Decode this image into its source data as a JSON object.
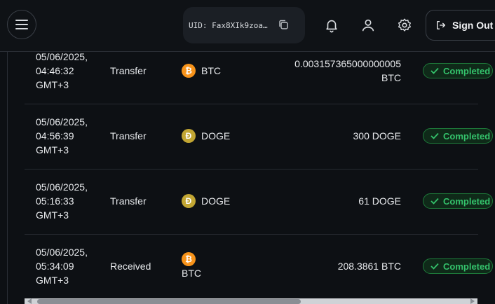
{
  "header": {
    "uid_text": "UID: Fax8XIk9zoa…",
    "signout_label": "Sign Out"
  },
  "transactions": [
    {
      "date_line1": "05/06/2025,",
      "date_line2": "04:46:32",
      "date_line3": "GMT+3",
      "type": "Transfer",
      "asset": "BTC",
      "amount_line1": "0.003157365000000005",
      "amount_line2": "BTC",
      "status": "Completed"
    },
    {
      "date_line1": "05/06/2025,",
      "date_line2": "04:56:39",
      "date_line3": "GMT+3",
      "type": "Transfer",
      "asset": "DOGE",
      "amount_line1": "300 DOGE",
      "status": "Completed"
    },
    {
      "date_line1": "05/06/2025,",
      "date_line2": "05:16:33",
      "date_line3": "GMT+3",
      "type": "Transfer",
      "asset": "DOGE",
      "amount_line1": "61 DOGE",
      "status": "Completed"
    },
    {
      "date_line1": "05/06/2025,",
      "date_line2": "05:34:09",
      "date_line3": "GMT+3",
      "type": "Received",
      "asset": "BTC",
      "amount_line1": "208.3861 BTC",
      "status": "Completed"
    }
  ],
  "colors": {
    "background": "#0d1014",
    "btc": "#f7931a",
    "doge": "#c2a633",
    "status_green": "#34c26b"
  },
  "icons": [
    "menu-icon",
    "copy-icon",
    "bell-icon",
    "user-icon",
    "gear-icon",
    "sign-out-icon",
    "bitcoin-icon",
    "dogecoin-icon",
    "check-icon"
  ]
}
